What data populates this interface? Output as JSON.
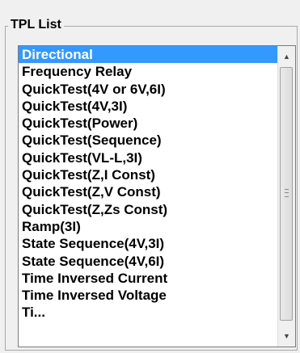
{
  "groupbox": {
    "title": "TPL List"
  },
  "list": {
    "items": [
      "Directional",
      "Frequency Relay",
      "QuickTest(4V or 6V,6I)",
      "QuickTest(4V,3I)",
      "QuickTest(Power)",
      "QuickTest(Sequence)",
      "QuickTest(VL-L,3I)",
      "QuickTest(Z,I Const)",
      "QuickTest(Z,V Const)",
      "QuickTest(Z,Zs Const)",
      "Ramp(3I)",
      "State Sequence(4V,3I)",
      "State Sequence(4V,6I)",
      "Time Inversed Current",
      "Time Inversed Voltage",
      "Ti..."
    ],
    "selected_index": 0
  },
  "scrollbar": {
    "up_icon": "arrow-up-icon",
    "down_icon": "arrow-down-icon",
    "selection_color": "#3399ff"
  }
}
